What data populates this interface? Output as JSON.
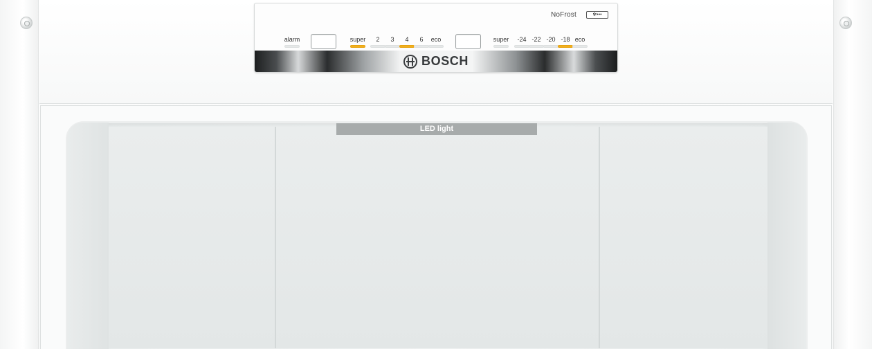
{
  "control_panel": {
    "nofrost_label": "NoFrost",
    "nofrost_badge": "✻•••",
    "fridge": {
      "alarm_label": "alarm",
      "settings": [
        "super",
        "2",
        "3",
        "4",
        "6",
        "eco"
      ],
      "active_setting": "4"
    },
    "freezer": {
      "settings": [
        "super",
        "-24",
        "-22",
        "-20",
        "-18",
        "eco"
      ],
      "active_setting": "-18"
    },
    "brand": "BOSCH",
    "indicator_color": "#f2b01e"
  },
  "interior": {
    "led_label": "LED light"
  }
}
